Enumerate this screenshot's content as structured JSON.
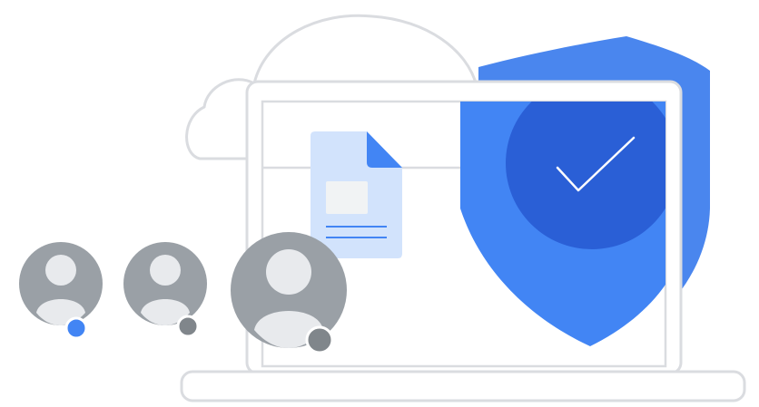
{
  "illustration": {
    "description_elements": {
      "cloud": "cloud-icon",
      "laptop": "laptop-icon",
      "shield": "shield-icon",
      "checkmark": "checkmark-icon",
      "document": "document-icon",
      "users": [
        "user-avatar-icon",
        "user-avatar-icon",
        "user-avatar-icon"
      ]
    },
    "colors": {
      "shield_light": "#4285f4",
      "shield_dark": "#2a5fd6",
      "shield_outline_fill": "#4a86ee",
      "document_fill": "#d2e3fc",
      "document_fold": "#4285f4",
      "document_lines": "#4285f4",
      "laptop_frame": "#ffffff",
      "laptop_stroke": "#dadce0",
      "cloud_stroke": "#dadce0",
      "avatar_bg": "#9aa0a6",
      "avatar_fg": "#e8eaed",
      "status_active": "#4285f4",
      "status_inactive": "#80868b"
    },
    "avatar_status": [
      "active",
      "inactive",
      "inactive"
    ]
  }
}
